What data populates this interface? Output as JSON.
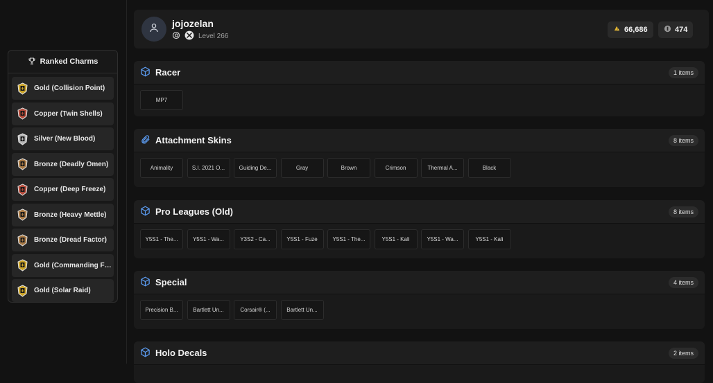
{
  "sidebar": {
    "title": "Ranked Charms",
    "items": [
      {
        "label": "Gold (Collision Point)",
        "tier": "gold"
      },
      {
        "label": "Copper (Twin Shells)",
        "tier": "copper"
      },
      {
        "label": "Silver (New Blood)",
        "tier": "silver"
      },
      {
        "label": "Bronze (Deadly Omen)",
        "tier": "bronze"
      },
      {
        "label": "Copper (Deep Freeze)",
        "tier": "copper"
      },
      {
        "label": "Bronze (Heavy Mettle)",
        "tier": "bronze"
      },
      {
        "label": "Bronze (Dread Factor)",
        "tier": "bronze"
      },
      {
        "label": "Gold (Commanding For...",
        "tier": "gold"
      },
      {
        "label": "Gold (Solar Raid)",
        "tier": "gold"
      }
    ]
  },
  "profile": {
    "username": "jojozelan",
    "level": "Level 266",
    "platform_icons": [
      "ubisoft-icon",
      "xbox-icon"
    ],
    "renown": "66,686",
    "credits": "474"
  },
  "sections": [
    {
      "title": "Racer",
      "icon": "cube-icon",
      "count": "1 items",
      "items": [
        "MP7"
      ]
    },
    {
      "title": "Attachment Skins",
      "icon": "paperclip-icon",
      "count": "8 items",
      "items": [
        "Animality",
        "S.I. 2021 O...",
        "Guiding De...",
        "Gray",
        "Brown",
        "Crimson",
        "Thermal A...",
        "Black"
      ]
    },
    {
      "title": "Pro Leagues (Old)",
      "icon": "cube-icon",
      "count": "8 items",
      "items": [
        "Y5S1 - The...",
        "Y5S1 - Wa...",
        "Y3S2 - Ca...",
        "Y5S1 - Fuze",
        "Y5S1 - The...",
        "Y5S1 - Kali",
        "Y5S1 - Wa...",
        "Y5S1 - Kali"
      ]
    },
    {
      "title": "Special",
      "icon": "cube-icon",
      "count": "4 items",
      "items": [
        "Precision B...",
        "Bartlett Un...",
        "Corsair® (...",
        "Bartlett Un..."
      ]
    },
    {
      "title": "Holo Decals",
      "icon": "cube-icon",
      "count": "2 items",
      "items": []
    }
  ],
  "colors": {
    "accent_blue": "#5b9bf0",
    "gold": "#c9a227",
    "copper": "#b34a3a",
    "silver": "#b8b8b8",
    "bronze": "#a97a45"
  }
}
